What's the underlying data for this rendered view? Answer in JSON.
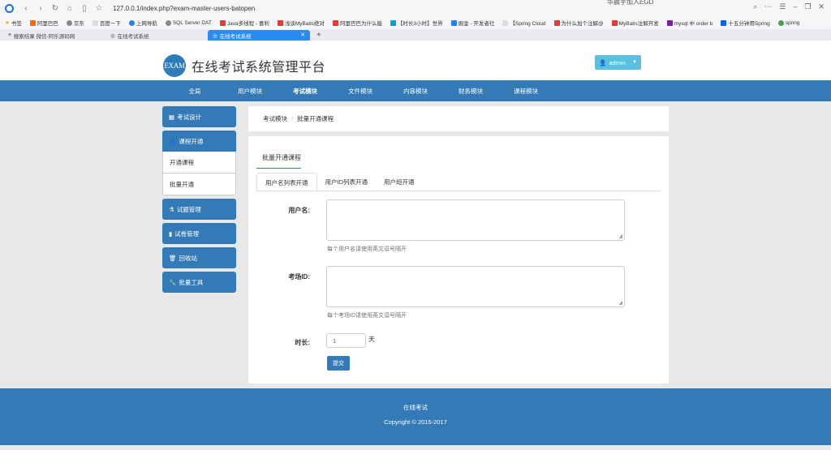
{
  "browser": {
    "url": "127.0.0.1/index.php?exam-master-users-batopen",
    "top_note": "华晨宇加入EGD",
    "bookmarks": [
      "书签",
      "阿里巴巴",
      "京东",
      "百度一下",
      "上网导航",
      "SQL Server DAT",
      "Java多线程 - 喜利",
      "浅谈MyBatis绝对",
      "阿里巴巴为什么能",
      "【时长3小时】世界",
      "掘金 - 开发者社",
      "【Spring Cloud",
      "为什么加个注解@",
      "MyBatis注解开发",
      "mysql 中 order b",
      "十五分钟用Spring",
      "spring"
    ],
    "tabs": [
      {
        "label": "搜索结果 微信-阿乐源码网"
      },
      {
        "label": "在线考试系统"
      },
      {
        "label": "在线考试系统"
      }
    ]
  },
  "header": {
    "logo_text": "EXAM",
    "title": "在线考试系统管理平台",
    "user_label": "admin"
  },
  "nav": {
    "items": [
      "全局",
      "用户模块",
      "考试模块",
      "文件模块",
      "内容模块",
      "财务模块",
      "课程模块"
    ],
    "active_index": 2
  },
  "sidebar": {
    "exam_design": "考试设计",
    "course_open": "课程开通",
    "open_course": "开通课程",
    "batch_open": "批量开通",
    "question_mgmt": "试题管理",
    "paper_mgmt": "试卷管理",
    "recycle": "回收站",
    "batch_tools": "批量工具"
  },
  "breadcrumb": {
    "item1": "考试模块",
    "item2": "批量开通课程"
  },
  "panel": {
    "title": "批量开通课程",
    "tabs": [
      "用户名列表开通",
      "用户ID列表开通",
      "用户组开通"
    ],
    "username_label": "用户名:",
    "username_help": "每个用户名请使用英文逗号隔开",
    "examid_label": "考场ID:",
    "examid_help": "每个考场ID请使用英文逗号隔开",
    "duration_label": "时长:",
    "duration_value": "1",
    "duration_unit": "天",
    "submit_label": "提交"
  },
  "footer": {
    "line1": "在线考试",
    "line2": "Copyright © 2015-2017"
  },
  "colors": {
    "primary": "#337ab7",
    "info": "#5bc0de",
    "background": "#e8e8e8"
  }
}
